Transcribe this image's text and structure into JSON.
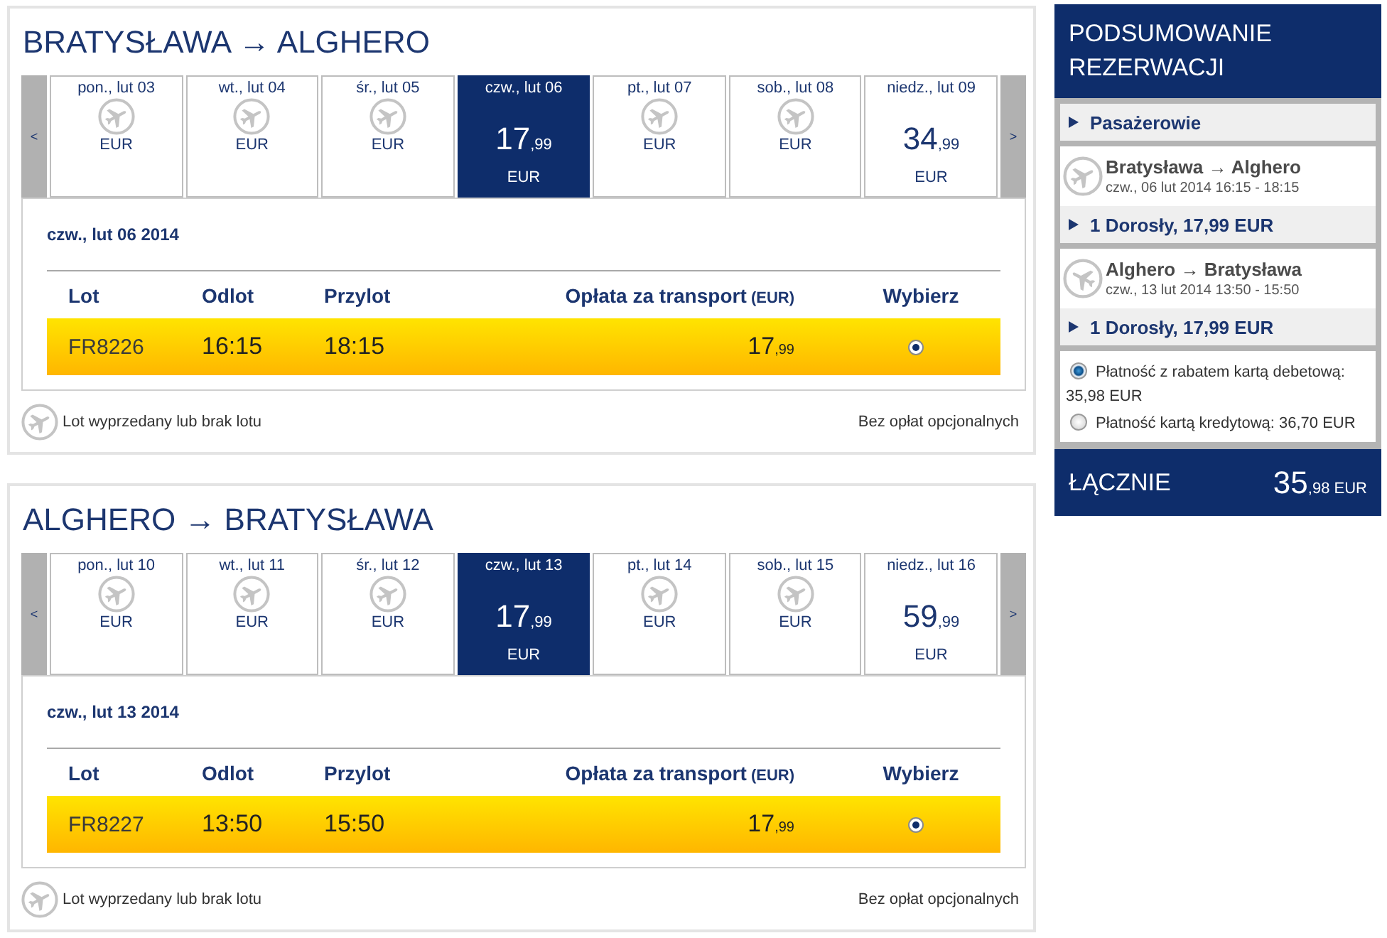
{
  "flights": [
    {
      "route": "BRATYSŁAWA → ALGHERO",
      "prev_label": "<",
      "next_label": ">",
      "days": [
        {
          "label": "pon., lut 03",
          "kind": "sold_out",
          "currency": "EUR",
          "selected": false
        },
        {
          "label": "wt., lut 04",
          "kind": "sold_out",
          "currency": "EUR",
          "selected": false
        },
        {
          "label": "śr., lut 05",
          "kind": "sold_out",
          "currency": "EUR",
          "selected": false
        },
        {
          "label": "czw., lut 06",
          "kind": "fare",
          "price": "17",
          "cents": ",99",
          "currency": "EUR",
          "selected": true
        },
        {
          "label": "pt., lut 07",
          "kind": "sold_out",
          "currency": "EUR",
          "selected": false
        },
        {
          "label": "sob., lut 08",
          "kind": "sold_out",
          "currency": "EUR",
          "selected": false
        },
        {
          "label": "niedz., lut 09",
          "kind": "fare",
          "price": "34",
          "cents": ",99",
          "currency": "EUR",
          "selected": false
        }
      ],
      "date_heading": "czw., lut 06 2014",
      "columns": [
        {
          "label": "Lot"
        },
        {
          "label": "Odlot"
        },
        {
          "label": "Przylot"
        },
        {
          "label": "Opłata za transport",
          "unit": "(EUR)"
        },
        {
          "label": "Wybierz"
        }
      ],
      "rows": [
        {
          "flight": "FR8226",
          "departure": "16:15",
          "arrival": "18:15",
          "price": "17",
          "cents": ",99",
          "selected": true
        }
      ],
      "legend": "Lot wyprzedany lub brak lotu",
      "note": "Bez opłat opcjonalnych"
    },
    {
      "route": "ALGHERO → BRATYSŁAWA",
      "prev_label": "<",
      "next_label": ">",
      "days": [
        {
          "label": "pon., lut 10",
          "kind": "sold_out",
          "currency": "EUR",
          "selected": false
        },
        {
          "label": "wt., lut 11",
          "kind": "sold_out",
          "currency": "EUR",
          "selected": false
        },
        {
          "label": "śr., lut 12",
          "kind": "sold_out",
          "currency": "EUR",
          "selected": false
        },
        {
          "label": "czw., lut 13",
          "kind": "fare",
          "price": "17",
          "cents": ",99",
          "currency": "EUR",
          "selected": true
        },
        {
          "label": "pt., lut 14",
          "kind": "sold_out",
          "currency": "EUR",
          "selected": false
        },
        {
          "label": "sob., lut 15",
          "kind": "sold_out",
          "currency": "EUR",
          "selected": false
        },
        {
          "label": "niedz., lut 16",
          "kind": "fare",
          "price": "59",
          "cents": ",99",
          "currency": "EUR",
          "selected": false
        }
      ],
      "date_heading": "czw., lut 13 2014",
      "columns": [
        {
          "label": "Lot"
        },
        {
          "label": "Odlot"
        },
        {
          "label": "Przylot"
        },
        {
          "label": "Opłata za transport",
          "unit": "(EUR)"
        },
        {
          "label": "Wybierz"
        }
      ],
      "rows": [
        {
          "flight": "FR8227",
          "departure": "13:50",
          "arrival": "15:50",
          "price": "17",
          "cents": ",99",
          "selected": true
        }
      ],
      "legend": "Lot wyprzedany lub brak lotu",
      "note": "Bez opłat opcjonalnych"
    }
  ],
  "summary": {
    "title": "PODSUMOWANIE REZERWACJI",
    "passengers_label": "Pasażerowie",
    "legs": [
      {
        "kind": "outbound",
        "route": "Bratysława → Alghero",
        "schedule": "czw., 06 lut 2014 16:15 - 18:15",
        "passengers": "1 Dorosły, 17,99 EUR"
      },
      {
        "kind": "inbound",
        "route": "Alghero → Bratysława",
        "schedule": "czw., 13 lut 2014 13:50 - 15:50",
        "passengers": "1 Dorosły, 17,99 EUR"
      }
    ],
    "payment_options": [
      {
        "label": "Płatność z rabatem kartą debetową: 35,98 EUR",
        "selected": true
      },
      {
        "label": "Płatność kartą kredytową: 36,70 EUR",
        "selected": false
      }
    ],
    "total": {
      "label": "ŁĄCZNIE",
      "amount": "35",
      "cents": ",98",
      "currency": "EUR"
    }
  }
}
